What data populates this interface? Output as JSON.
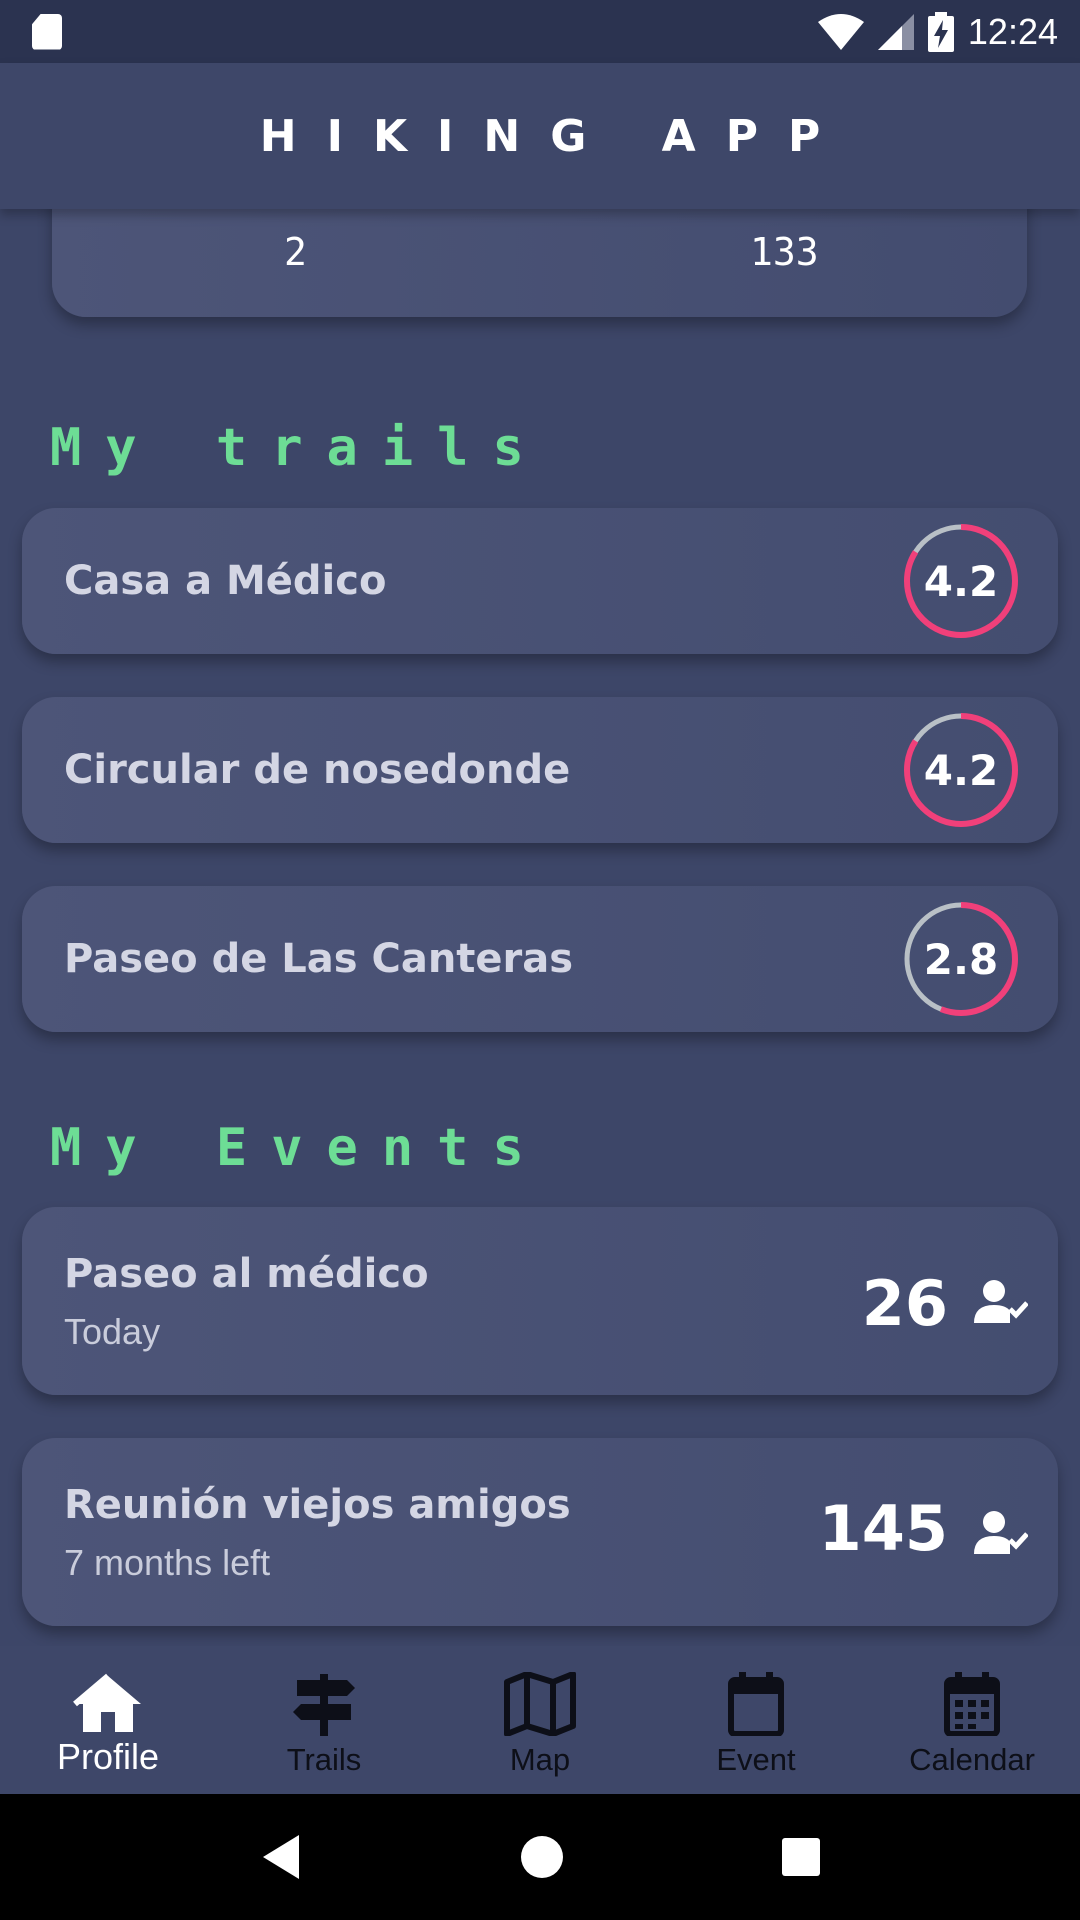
{
  "status_bar": {
    "time": "12:24"
  },
  "header": {
    "title": "HIKING APP"
  },
  "stats": {
    "values": [
      "2",
      "133"
    ]
  },
  "trails_section": {
    "title": "My trails",
    "items": [
      {
        "name": "Casa a Médico",
        "rating": "4.2",
        "fill": 0.84
      },
      {
        "name": "Circular de nosedonde",
        "rating": "4.2",
        "fill": 0.84
      },
      {
        "name": "Paseo de Las Canteras",
        "rating": "2.8",
        "fill": 0.56
      }
    ]
  },
  "events_section": {
    "title": "My Events",
    "items": [
      {
        "name": "Paseo al médico",
        "time": "Today",
        "count": "26"
      },
      {
        "name": "Reunión viejos amigos",
        "time": "7 months left",
        "count": "145"
      }
    ]
  },
  "bottom_nav": {
    "items": [
      {
        "label": "Profile",
        "icon": "home-icon",
        "active": true
      },
      {
        "label": "Trails",
        "icon": "signpost-icon",
        "active": false
      },
      {
        "label": "Map",
        "icon": "map-icon",
        "active": false
      },
      {
        "label": "Event",
        "icon": "event-icon",
        "active": false
      },
      {
        "label": "Calendar",
        "icon": "calendar-icon",
        "active": false
      }
    ]
  },
  "colors": {
    "accent": "#6ddd95",
    "rating_ring": "#f0407a",
    "ring_track": "#b9c0c6"
  }
}
